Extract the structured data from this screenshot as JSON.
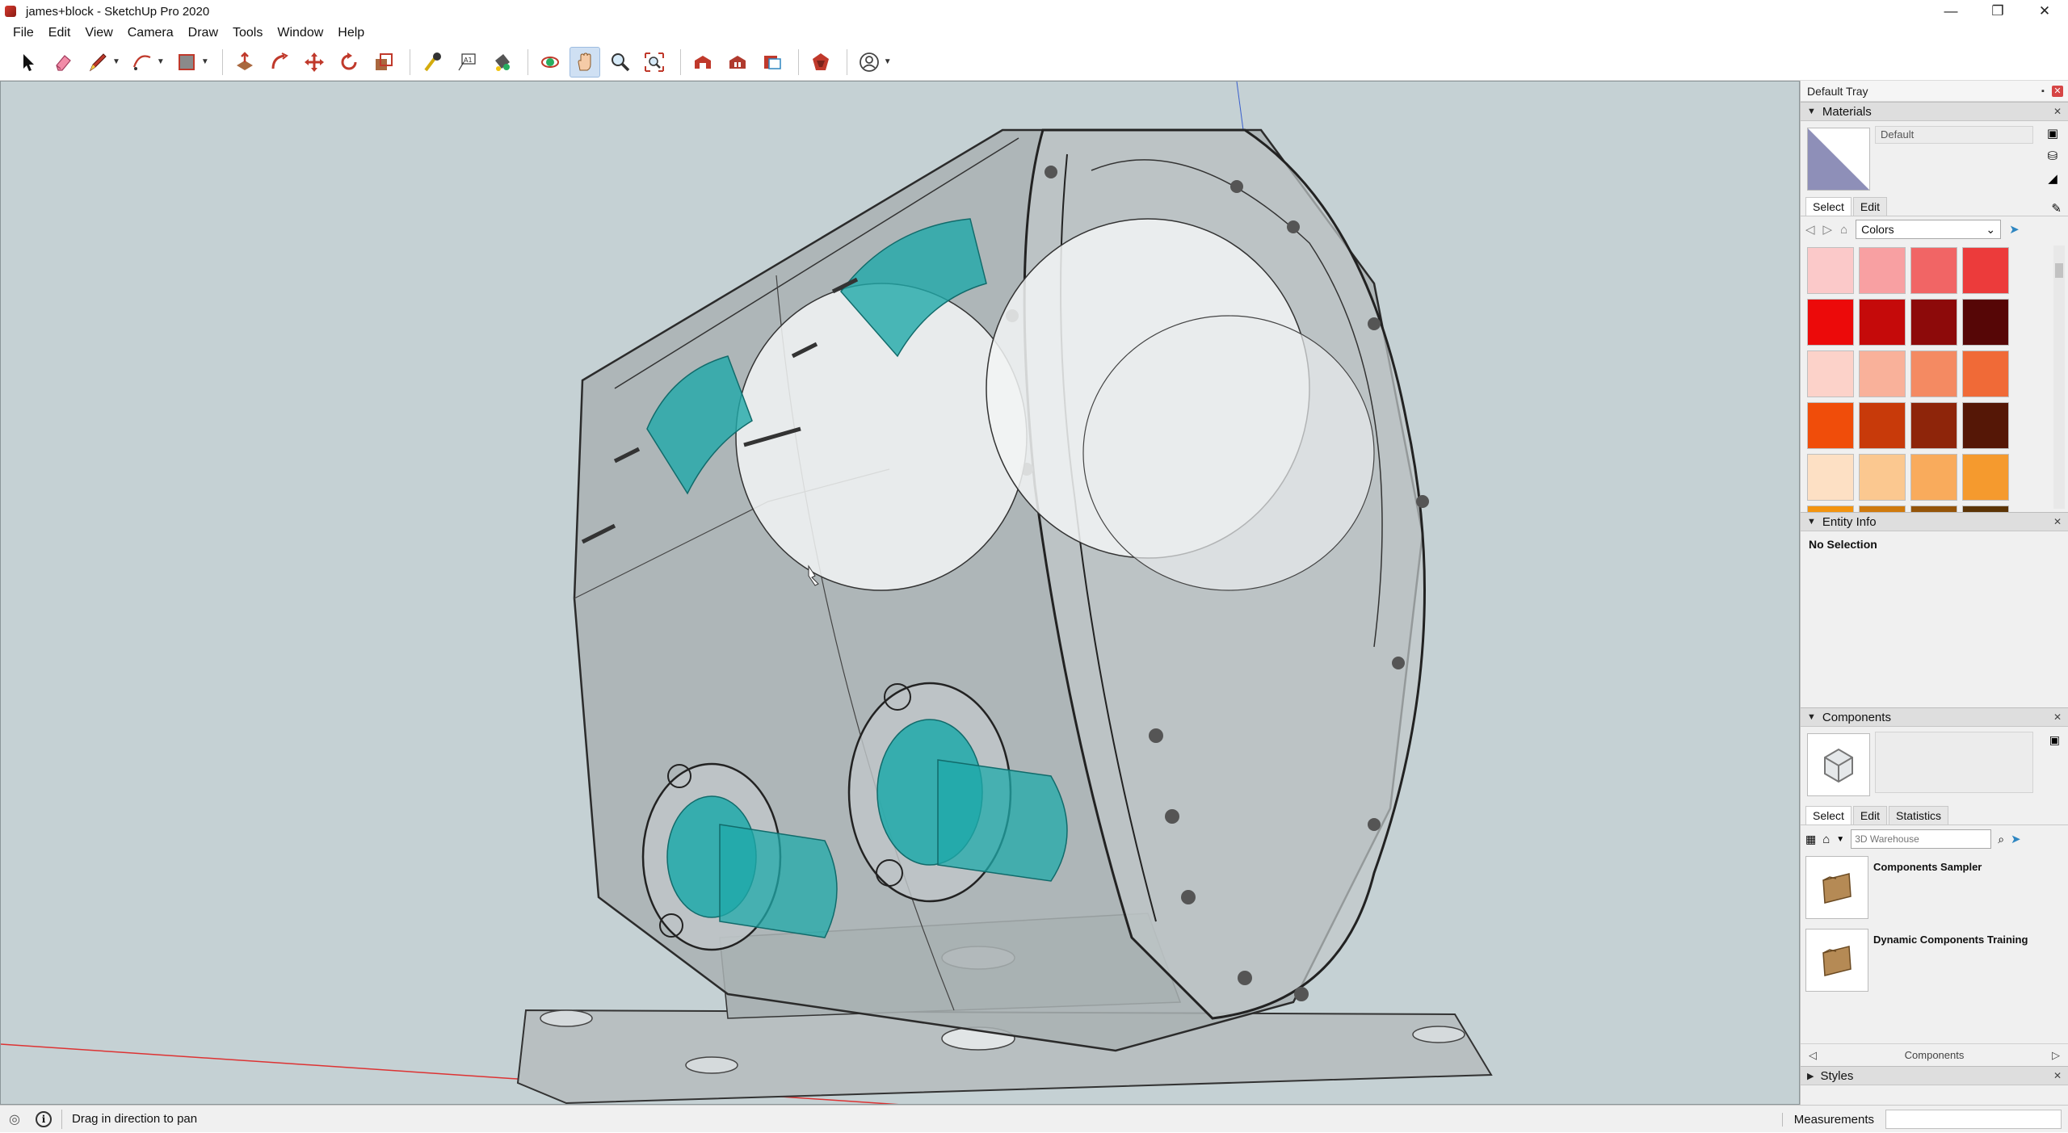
{
  "window": {
    "title": "james+block - SketchUp Pro 2020",
    "controls": [
      "—",
      "❐",
      "✕"
    ]
  },
  "menu": [
    "File",
    "Edit",
    "View",
    "Camera",
    "Draw",
    "Tools",
    "Window",
    "Help"
  ],
  "tray": {
    "title": "Default Tray",
    "materials": {
      "header": "Materials",
      "current_name": "Default",
      "tabs": [
        "Select",
        "Edit"
      ],
      "library": "Colors",
      "swatches": [
        [
          "#fbc9c9",
          "#f8a0a2",
          "#f16565",
          "#ec3b3b"
        ],
        [
          "#ec0a0a",
          "#c50a0a",
          "#8d0a0a",
          "#560606"
        ],
        [
          "#fcd2c9",
          "#f9b19a",
          "#f48a62",
          "#f06a37"
        ],
        [
          "#f04d0a",
          "#c83a0a",
          "#8e250a",
          "#551706"
        ],
        [
          "#fde0c4",
          "#fbc890",
          "#f9ab5c",
          "#f59a2e"
        ],
        [
          "#f39410",
          "#cf7a0e",
          "#94540a",
          "#5b3406"
        ]
      ]
    },
    "entity_info": {
      "header": "Entity Info",
      "status": "No Selection"
    },
    "components": {
      "header": "Components",
      "tabs": [
        "Select",
        "Edit",
        "Statistics"
      ],
      "search_placeholder": "3D Warehouse",
      "items": [
        "Components Sampler",
        "Dynamic Components Training"
      ],
      "footer_label": "Components"
    },
    "styles": {
      "header": "Styles"
    }
  },
  "status": {
    "hint": "Drag in direction to pan",
    "measurements_label": "Measurements",
    "measurements_value": ""
  }
}
